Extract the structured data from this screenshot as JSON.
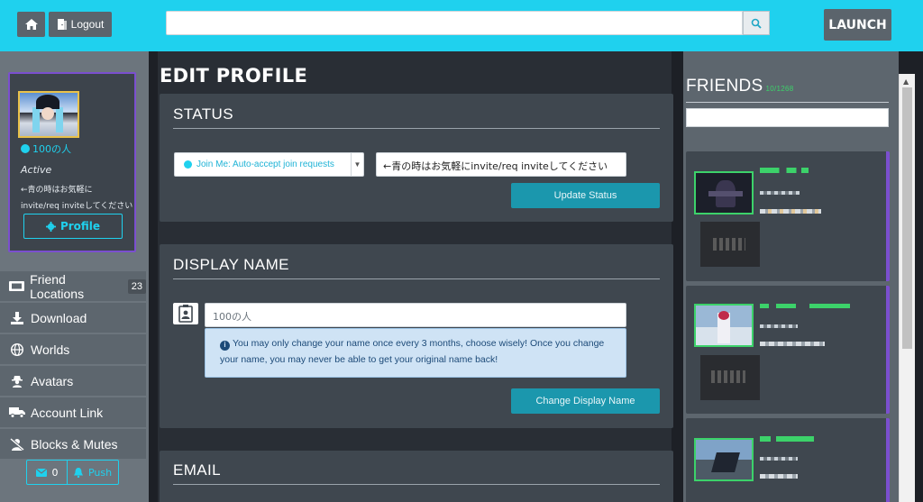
{
  "topbar": {
    "logout_label": "Logout",
    "search_value": "",
    "launch_label": "LAUNCH",
    "accent": "#1fd1ee"
  },
  "user": {
    "name": "100の人",
    "status": "Active",
    "description": "←青の時はお気軽に invite/req inviteしてください",
    "profile_label": "Profile"
  },
  "nav": {
    "items": [
      {
        "label": "Friend Locations",
        "icon": "ticket-icon",
        "badge": "23"
      },
      {
        "label": "Download",
        "icon": "download-icon"
      },
      {
        "label": "Worlds",
        "icon": "globe-icon"
      },
      {
        "label": "Avatars",
        "icon": "user-secret-icon"
      },
      {
        "label": "Account Link",
        "icon": "truck-icon"
      },
      {
        "label": "Blocks & Mutes",
        "icon": "user-slash-icon"
      }
    ],
    "messages_count": "0",
    "push_label": "Push"
  },
  "main": {
    "title": "EDIT PROFILE",
    "status_panel": {
      "title": "STATUS",
      "select_value": "Join Me: Auto-accept join requests",
      "status_text": "←青の時はお気軽にinvite/req inviteしてください",
      "button": "Update Status"
    },
    "display_name_panel": {
      "title": "DISPLAY NAME",
      "input_placeholder": "100の人",
      "info": "You may only change your name once every 3 months, choose wisely! Once you change your name, you may never be able to get your original name back!",
      "button": "Change Display Name"
    },
    "email_panel": {
      "title": "EMAIL"
    }
  },
  "friends": {
    "title": "FRIENDS",
    "count": "10/1268"
  }
}
